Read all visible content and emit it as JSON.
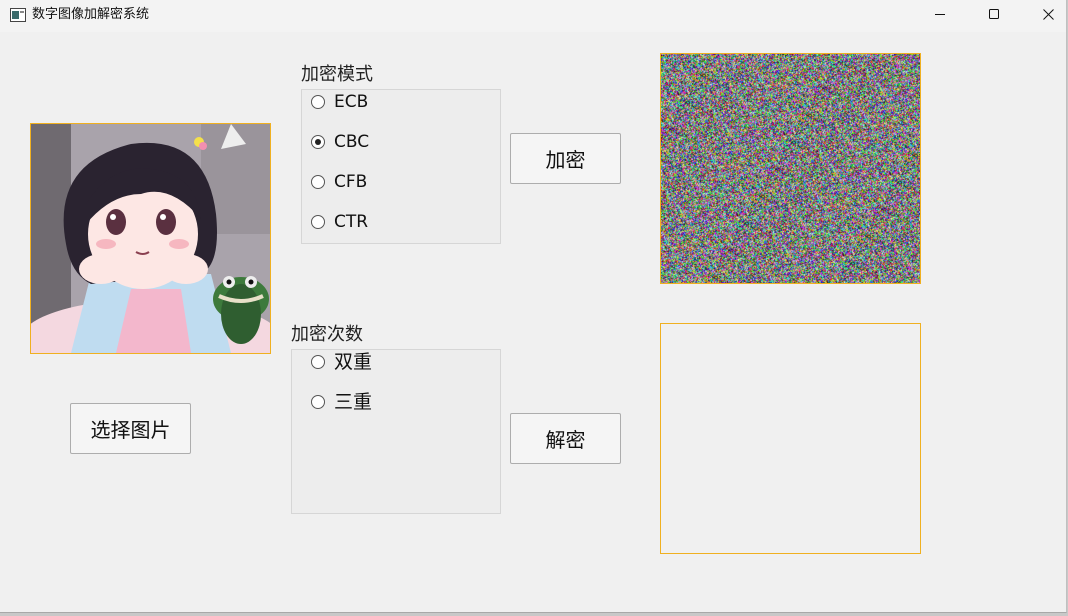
{
  "window": {
    "title": "数字图像加解密系统",
    "icon": "app-window-icon",
    "controls": [
      "minimize-icon",
      "maximize-icon",
      "close-icon"
    ]
  },
  "source_image": {
    "label": "source-image-anime-girl"
  },
  "mode_group": {
    "label": "加密模式",
    "options": [
      {
        "label": "ECB",
        "checked": false
      },
      {
        "label": "CBC",
        "checked": true
      },
      {
        "label": "CFB",
        "checked": false
      },
      {
        "label": "CTR",
        "checked": false
      }
    ]
  },
  "rounds_group": {
    "label": "加密次数",
    "options": [
      {
        "label": "双重",
        "checked": false
      },
      {
        "label": "三重",
        "checked": false
      }
    ]
  },
  "buttons": {
    "select_image": "选择图片",
    "encrypt": "加密",
    "decrypt": "解密"
  },
  "colors": {
    "image_border": "#f0b020",
    "window_bg": "#f0f0f0"
  }
}
